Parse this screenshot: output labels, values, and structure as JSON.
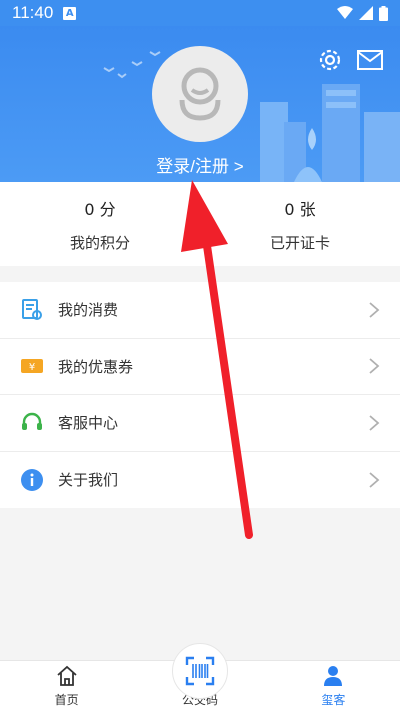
{
  "status_bar": {
    "time": "11:40",
    "notification_letter": "A",
    "icons": [
      "wifi-icon",
      "signal-icon",
      "battery-icon"
    ]
  },
  "header": {
    "login_label": "登录/注册",
    "chevron": ">",
    "icons": [
      "settings-gear-icon",
      "mail-icon",
      "default-avatar-icon"
    ],
    "background_color": "#3d8ff0"
  },
  "stats": [
    {
      "value": "0 分",
      "label": "我的积分"
    },
    {
      "value": "0 张",
      "label": "已开证卡"
    }
  ],
  "menu": [
    {
      "label": "我的消费",
      "icon": "receipt-icon",
      "color": "#3aa0e8"
    },
    {
      "label": "我的优惠券",
      "icon": "coupon-icon",
      "color": "#f5a623"
    },
    {
      "label": "客服中心",
      "icon": "headset-icon",
      "color": "#3cb34a"
    },
    {
      "label": "关于我们",
      "icon": "info-icon",
      "color": "#3d8ff0"
    }
  ],
  "bottom_nav": [
    {
      "label": "首页",
      "icon": "home-icon",
      "active": false
    },
    {
      "label": "公交码",
      "icon": "scan-code-icon",
      "active": false
    },
    {
      "label": "玺客",
      "icon": "user-icon",
      "active": true
    }
  ],
  "colors": {
    "accent": "#2a7ff0",
    "annotation_arrow": "#f0202a"
  }
}
